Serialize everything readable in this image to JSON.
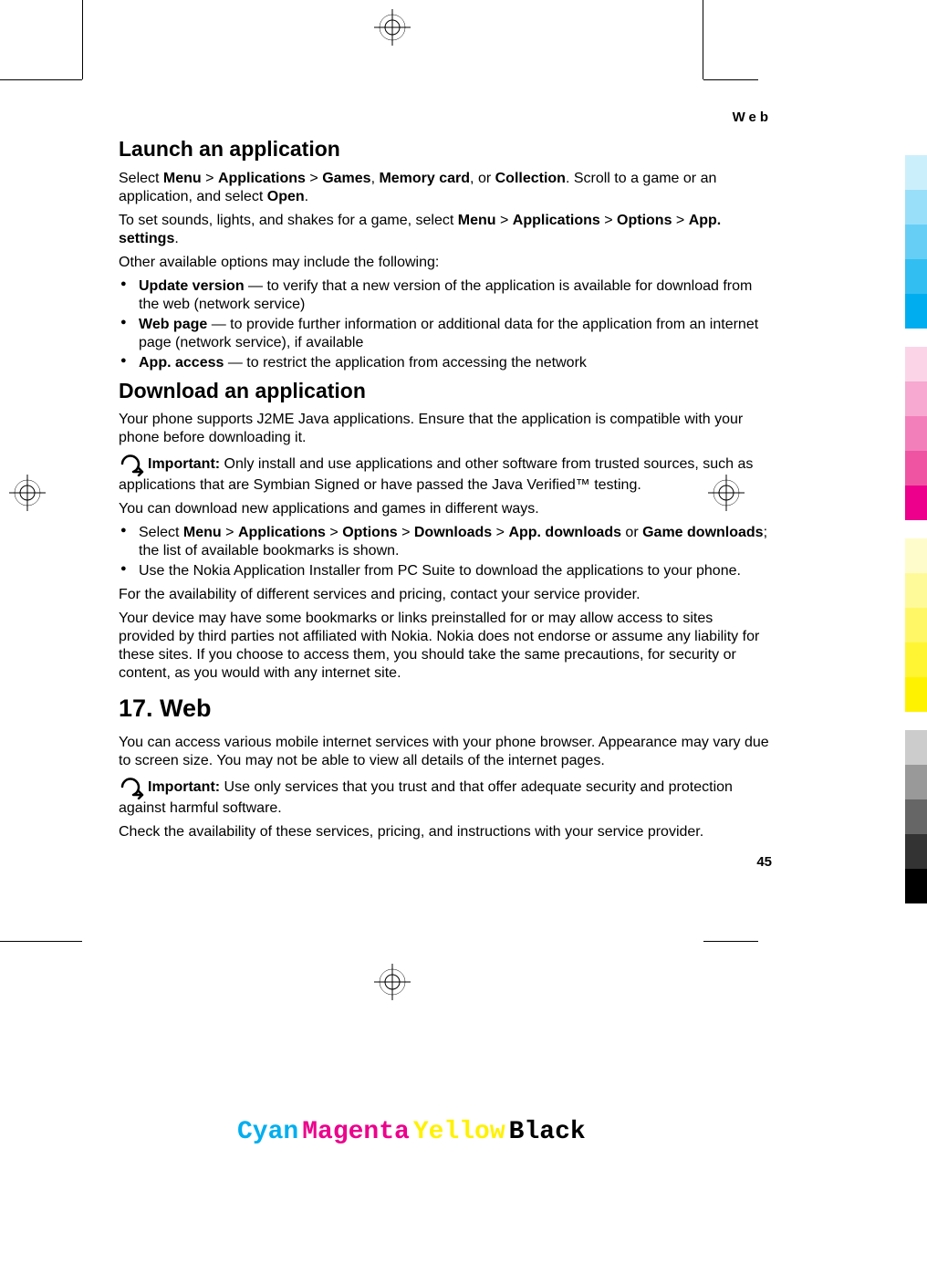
{
  "running_head": "Web",
  "h1": "Launch an application",
  "p1a": "Select ",
  "p1b": "Menu",
  "p1c": " > ",
  "p1d": "Applications",
  "p1e": " > ",
  "p1f": "Games",
  "p1g": ", ",
  "p1h": "Memory card",
  "p1i": ", or ",
  "p1j": "Collection",
  "p1k": ". Scroll to a game or an application, and select ",
  "p1l": "Open",
  "p1m": ".",
  "p2a": "To set sounds, lights, and shakes for a game, select ",
  "p2b": "Menu",
  "p2c": " > ",
  "p2d": "Applications",
  "p2e": " > ",
  "p2f": "Options",
  "p2g": " > ",
  "p2h": "App. settings",
  "p2i": ".",
  "p3": "Other available options may include the following:",
  "li1a": "Update version",
  "li1b": "  — to verify that a new version of the application is available for download from the web (network service)",
  "li2a": "Web page",
  "li2b": " —  to provide further information or additional data for the application from an internet page (network service), if available",
  "li3a": "App. access",
  "li3b": " —  to restrict the application from accessing the network",
  "h2": "Download an application",
  "p4": "Your phone supports J2ME Java applications. Ensure that the application is compatible with your phone before downloading it.",
  "imp1a": "Important:",
  "imp1b": "  Only install and use applications and other software from trusted sources, such as applications that are Symbian Signed or have passed the Java Verified™ testing.",
  "p5": "You can download new applications and games in different ways.",
  "li4a": "Select ",
  "li4b": "Menu",
  "li4c": " > ",
  "li4d": "Applications",
  "li4e": " > ",
  "li4f": "Options",
  "li4g": " > ",
  "li4h": "Downloads",
  "li4i": " > ",
  "li4j": "App. downloads",
  "li4k": " or ",
  "li4l": "Game downloads",
  "li4m": "; the list of available bookmarks is shown.",
  "li5": "Use the Nokia Application Installer from PC Suite to download the applications to your phone.",
  "p6": "For the availability of different services and pricing, contact your service provider.",
  "p7": "Your device may have some bookmarks or links preinstalled for or may allow access to sites provided by third parties not affiliated with Nokia. Nokia does not endorse or assume any liability for these sites. If you choose to access them, you should take the same precautions, for security or content, as you would with any internet site.",
  "h3": "17.   Web",
  "p8": "You can access various mobile internet services with your phone browser. Appearance may vary due to screen size. You may not be able to view all details of the internet pages.",
  "imp2a": "Important:",
  "imp2b": "  Use only services that you trust and that offer adequate security and protection against harmful software.",
  "p9": "Check the availability of these services, pricing, and instructions with your service provider.",
  "page_num": "45",
  "footer": {
    "c": "Cyan",
    "m": "Magenta",
    "y": "Yellow",
    "k": "Black"
  }
}
